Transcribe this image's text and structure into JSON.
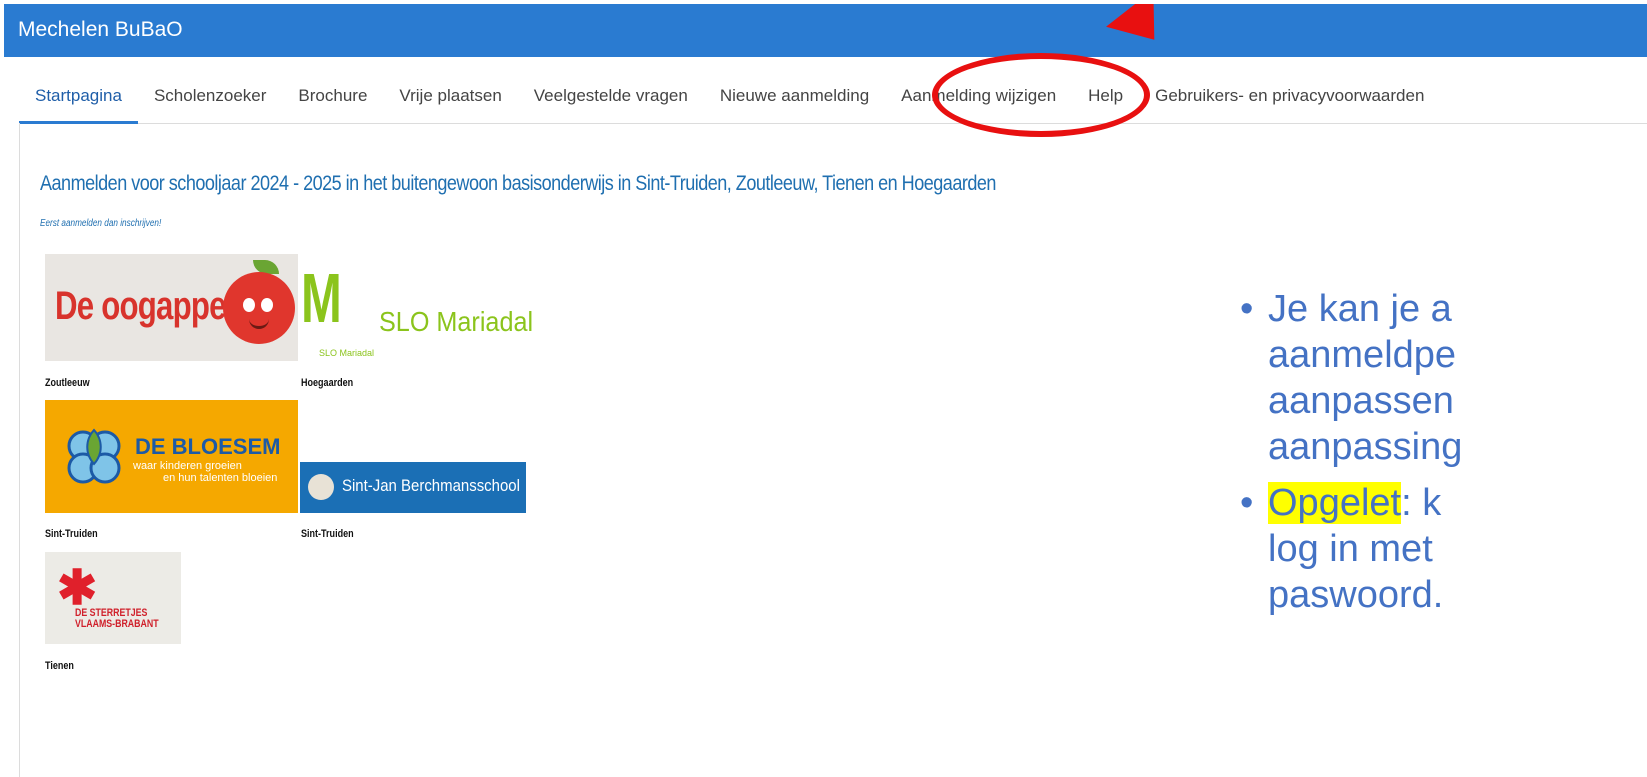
{
  "app": {
    "title": "Mechelen BuBaO"
  },
  "nav": {
    "items": [
      "Startpagina",
      "Scholenzoeker",
      "Brochure",
      "Vrije plaatsen",
      "Veelgestelde vragen",
      "Nieuwe aanmelding",
      "Aanmelding wijzigen",
      "Help",
      "Gebruikers- en privacyvoorwaarden"
    ],
    "active": "Startpagina",
    "highlighted": "Aanmelding wijzigen"
  },
  "main": {
    "heading": "Aanmelden voor schooljaar 2024 - 2025 in het buitengewoon basisonderwijs in Sint-Truiden, Zoutleeuw, Tienen en Hoegaarden",
    "subheading": "Eerst aanmelden dan inschrijven!",
    "schools": [
      {
        "logo_text": "De oogappel",
        "caption": "Zoutleeuw"
      },
      {
        "logo_text": "SLO Mariadal",
        "logo_small": "SLO Mariadal",
        "caption": "Hoegaarden"
      },
      {
        "logo_title": "DE BLOESEM",
        "logo_line1": "waar kinderen groeien",
        "logo_line2": "en hun talenten bloeien",
        "caption": "Sint-Truiden"
      },
      {
        "logo_text": "Sint-Jan Berchmansschool",
        "caption": "Sint-Truiden"
      },
      {
        "logo_line1": "DE STERRETJES",
        "logo_line2": "VLAAMS-BRABANT",
        "caption": "Tienen"
      }
    ]
  },
  "slide": {
    "bullet1": [
      "Je kan je a",
      "aanmeldpe",
      "aanpassen",
      "aanpassing"
    ],
    "bullet2_highlight": "Opgelet",
    "bullet2_rest": ": k",
    "bullet2_lines": [
      "log in met",
      "paswoord."
    ]
  },
  "colors": {
    "topbar": "#2a7bd1",
    "accent": "#1f6fb0",
    "annotation": "#e81010",
    "slide_text": "#4472c4",
    "highlight": "#ffff00"
  }
}
